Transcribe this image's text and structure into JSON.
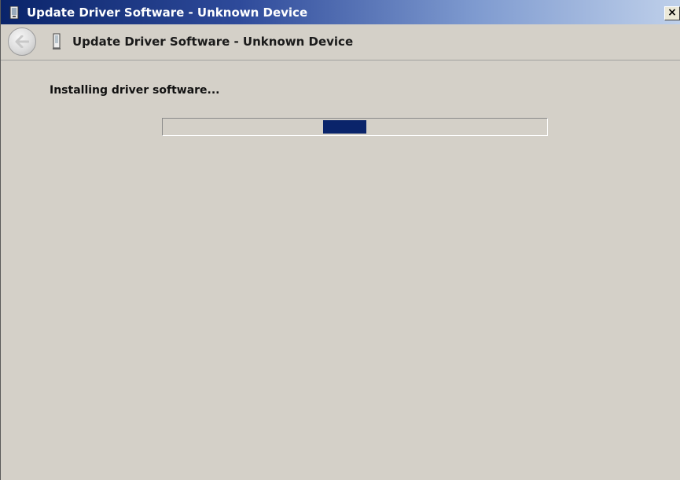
{
  "window": {
    "title": "Update Driver Software - Unknown Device",
    "close_label": "×"
  },
  "header": {
    "title": "Update Driver Software - Unknown Device"
  },
  "main": {
    "status": "Installing driver software...",
    "progress": {
      "mode": "indeterminate",
      "position_fraction": 0.47
    }
  },
  "icons": {
    "title_icon": "device-icon",
    "back": "back-arrow-icon",
    "header_icon": "device-icon"
  },
  "colors": {
    "titlebar_start": "#0a246a",
    "titlebar_end": "#bfd0ea",
    "window_bg": "#d4d0c8",
    "progress_chunk": "#0a246a"
  }
}
